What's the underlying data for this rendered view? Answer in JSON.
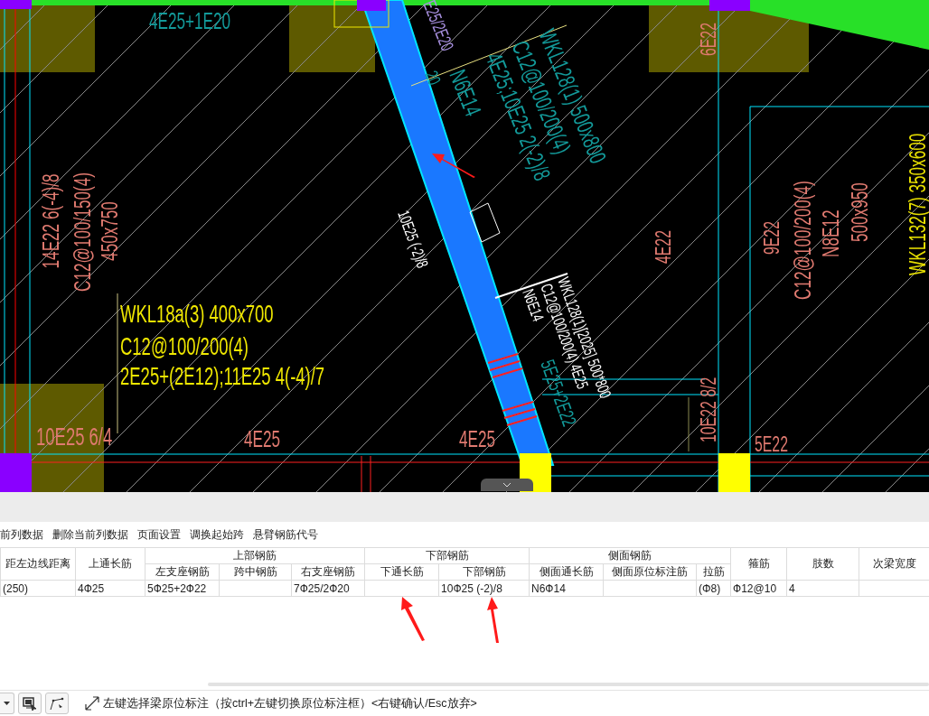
{
  "drawing": {
    "labels": [
      {
        "lines": [
          "4E25+1E20"
        ],
        "color": "#139a9a"
      },
      {
        "lines": [
          "E25/2E20"
        ],
        "color": "#a890e0"
      },
      {
        "lines": [
          "20"
        ],
        "color": "#139a9a"
      },
      {
        "lines": [
          "WKL128(1) 500x800",
          "C12@100/200(4)",
          "4E25;10E25 2(-2)/8",
          "N6E14"
        ],
        "color": "#139a9a"
      },
      {
        "lines": [
          "14E22 6(-4)/8",
          "C12@100/150(4)",
          "450x750"
        ],
        "color": "#e07a70"
      },
      {
        "lines": [
          "WKL18a(3) 400x700",
          "C12@100/200(4)",
          "2E25+(2E12);11E25 4(-4)/7"
        ],
        "color": "#f0e800"
      },
      {
        "lines": [
          "10E25 6/4"
        ],
        "color": "#e07a70"
      },
      {
        "lines": [
          "4E25"
        ],
        "color": "#e07a70"
      },
      {
        "lines": [
          "4E25"
        ],
        "color": "#e07a70"
      },
      {
        "lines": [
          "10E25 (-2)/8"
        ],
        "color": "#ffffff"
      },
      {
        "lines": [
          "WKL128(1)[2025] 500*800",
          "C12@100/200(4) 4E25",
          "N6E14"
        ],
        "color": "#ffffff"
      },
      {
        "lines": [
          "5E25+2E22"
        ],
        "color": "#139a9a"
      },
      {
        "lines": [
          "6E22"
        ],
        "color": "#e07a70"
      },
      {
        "lines": [
          "4E22"
        ],
        "color": "#e07a70"
      },
      {
        "lines": [
          "9E22"
        ],
        "color": "#e07a70"
      },
      {
        "lines": [
          "C12@100/200(4)",
          "N8E12",
          "500x950"
        ],
        "color": "#e07a70"
      },
      {
        "lines": [
          "WKL132(7) 350x600"
        ],
        "color": "#e8e000"
      },
      {
        "lines": [
          "10E22 8/2"
        ],
        "color": "#e07a70"
      },
      {
        "lines": [
          "5E22"
        ],
        "color": "#e07a70"
      }
    ]
  },
  "menu": [
    "前列数据",
    "删除当前列数据",
    "页面设置",
    "调换起始跨",
    "悬臂钢筋代号"
  ],
  "table": {
    "header": [
      {
        "label": "距左边线距离"
      },
      {
        "label": "上通长筋"
      },
      {
        "label": "上部钢筋",
        "children": [
          {
            "label": "左支座钢筋"
          },
          {
            "label": "跨中钢筋"
          },
          {
            "label": "右支座钢筋"
          }
        ]
      },
      {
        "label": "下部钢筋",
        "children": [
          {
            "label": "下通长筋"
          },
          {
            "label": "下部钢筋"
          }
        ]
      },
      {
        "label": "侧面钢筋",
        "children": [
          {
            "label": "侧面通长筋"
          },
          {
            "label": "侧面原位标注筋"
          },
          {
            "label": "拉筋"
          }
        ]
      },
      {
        "label": "箍筋"
      },
      {
        "label": "肢数"
      },
      {
        "label": "次梁宽度"
      }
    ],
    "rows": [
      [
        "(250)",
        "4Ф25",
        "5Ф25+2Ф22",
        "",
        "7Ф25/2Ф20",
        "",
        "10Ф25 (-2)/8",
        "N6Ф14",
        "",
        "(Φ8)",
        "Ф12@10",
        "4",
        ""
      ]
    ]
  },
  "status_bar": {
    "hint": "左键选择梁原位标注（按ctrl+左键切换原位标注框）<右键确认/Esc放弃>"
  }
}
